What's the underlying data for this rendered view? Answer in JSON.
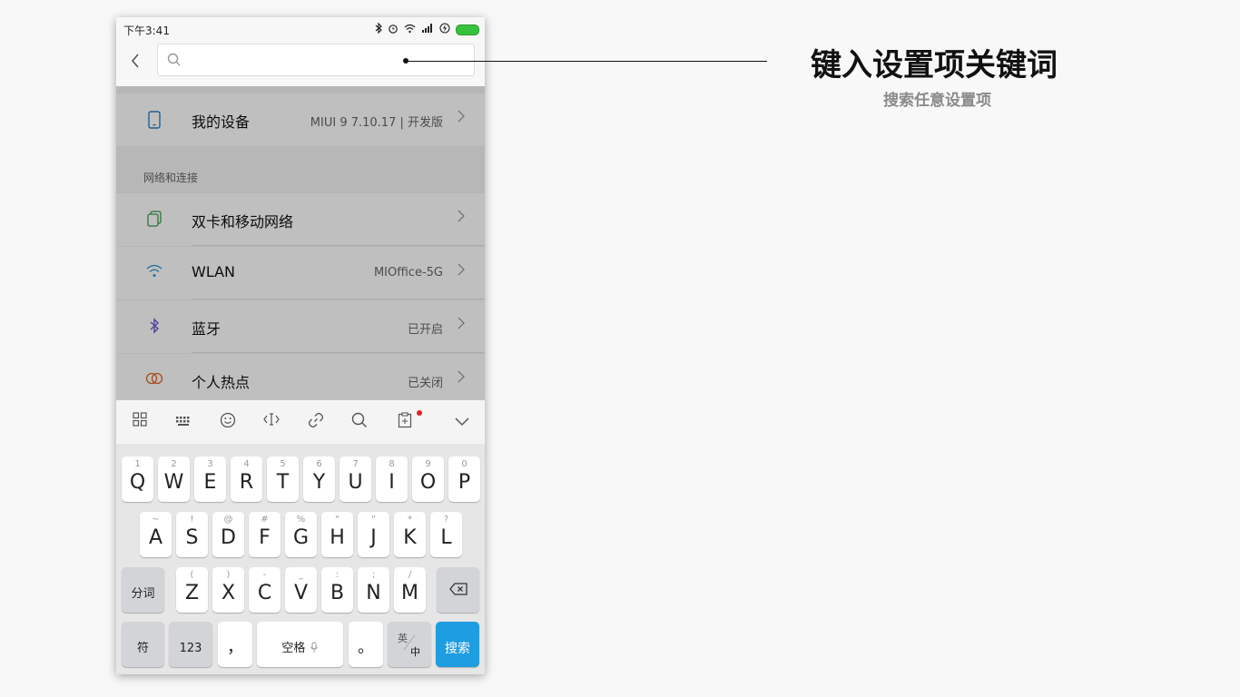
{
  "status_bar": {
    "time": "下午3:41",
    "icons": [
      "bluetooth-icon",
      "alarm-icon",
      "wifi-icon",
      "signal-icon",
      "charging-icon",
      "battery-icon"
    ]
  },
  "search": {
    "placeholder": "",
    "value": ""
  },
  "settings": {
    "device": {
      "label": "我的设备",
      "value": "MIUI 9 7.10.17 | 开发版"
    },
    "section_title": "网络和连接",
    "items": [
      {
        "label": "双卡和移动网络",
        "value": ""
      },
      {
        "label": "WLAN",
        "value": "MIOffice-5G"
      },
      {
        "label": "蓝牙",
        "value": "已开启"
      },
      {
        "label": "个人热点",
        "value": "已关闭"
      }
    ]
  },
  "keyboard": {
    "row1": [
      {
        "k": "Q",
        "h": "1"
      },
      {
        "k": "W",
        "h": "2"
      },
      {
        "k": "E",
        "h": "3"
      },
      {
        "k": "R",
        "h": "4"
      },
      {
        "k": "T",
        "h": "5"
      },
      {
        "k": "Y",
        "h": "6"
      },
      {
        "k": "U",
        "h": "7"
      },
      {
        "k": "I",
        "h": "8"
      },
      {
        "k": "O",
        "h": "9"
      },
      {
        "k": "P",
        "h": "0"
      }
    ],
    "row2": [
      {
        "k": "A",
        "h": "~"
      },
      {
        "k": "S",
        "h": "!"
      },
      {
        "k": "D",
        "h": "@"
      },
      {
        "k": "F",
        "h": "#"
      },
      {
        "k": "G",
        "h": "%"
      },
      {
        "k": "H",
        "h": "\""
      },
      {
        "k": "J",
        "h": "\""
      },
      {
        "k": "K",
        "h": "*"
      },
      {
        "k": "L",
        "h": "?"
      }
    ],
    "row3": [
      {
        "k": "Z",
        "h": "("
      },
      {
        "k": "X",
        "h": ")"
      },
      {
        "k": "C",
        "h": "-"
      },
      {
        "k": "V",
        "h": "_"
      },
      {
        "k": "B",
        "h": ":"
      },
      {
        "k": "N",
        "h": ";"
      },
      {
        "k": "M",
        "h": "/"
      }
    ],
    "fenci": "分词",
    "fu": "符",
    "num": "123",
    "comma": "，",
    "space": "空格",
    "period": "。",
    "lang_en": "英",
    "lang_zh": "中",
    "search": "搜索"
  },
  "callout": {
    "title": "键入设置项关键词",
    "subtitle": "搜索任意设置项"
  }
}
